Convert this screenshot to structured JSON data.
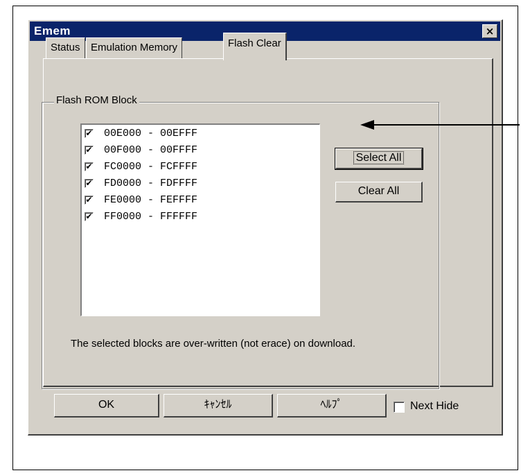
{
  "window": {
    "title": "Emem",
    "close_glyph": "×"
  },
  "tabs": [
    {
      "label": "Status",
      "active": false
    },
    {
      "label": "Emulation Memory",
      "active": false
    },
    {
      "label": "Flash Clear",
      "active": true
    }
  ],
  "group": {
    "label": "Flash ROM Block"
  },
  "blocks": [
    {
      "range": "00E000 - 00EFFF",
      "checked": true
    },
    {
      "range": "00F000 - 00FFFF",
      "checked": true
    },
    {
      "range": "FC0000 - FCFFFF",
      "checked": true
    },
    {
      "range": "FD0000 - FDFFFF",
      "checked": true
    },
    {
      "range": "FE0000 - FEFFFF",
      "checked": true
    },
    {
      "range": "FF0000 - FFFFFF",
      "checked": true
    }
  ],
  "check_glyph": "✔",
  "buttons": {
    "select_all": "Select All",
    "clear_all": "Clear All",
    "ok": "OK",
    "cancel": "ｷｬﾝｾﾙ",
    "help": "ﾍﾙﾌﾟ"
  },
  "note": "The selected blocks are over-written (not erace) on download.",
  "next_hide": {
    "label": "Next Hide",
    "checked": false
  },
  "colors": {
    "titlebar": "#0a246a",
    "dialog_bg": "#d4d0c8"
  }
}
